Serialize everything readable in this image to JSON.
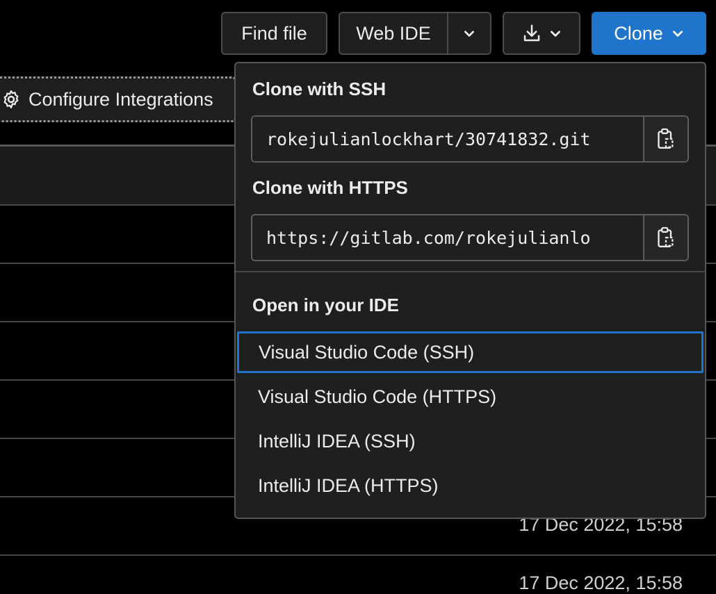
{
  "toolbar": {
    "find_file": "Find file",
    "web_ide": "Web IDE",
    "clone": "Clone",
    "icons": {
      "web_ide_caret": "chevron-down-icon",
      "download": "download-icon",
      "download_caret": "chevron-down-icon",
      "clone_caret": "chevron-down-icon"
    }
  },
  "configure": {
    "label": "Configure Integrations",
    "icon": "gear-icon"
  },
  "rows": [
    {
      "date": "17 Dec 2022, 15:58"
    },
    {
      "date": "17 Dec 2022, 15:58"
    }
  ],
  "clone_dropdown": {
    "ssh_title": "Clone with SSH",
    "ssh_value": "rokejulianlockhart/30741832.git",
    "https_title": "Clone with HTTPS",
    "https_value": "https://gitlab.com/rokejulianlo",
    "ide_title": "Open in your IDE",
    "ide_items": [
      {
        "label": "Visual Studio Code (SSH)"
      },
      {
        "label": "Visual Studio Code (HTTPS)"
      },
      {
        "label": "IntelliJ IDEA (SSH)"
      },
      {
        "label": "IntelliJ IDEA (HTTPS)"
      }
    ],
    "copy_icon": "copy-to-clipboard-icon"
  },
  "colors": {
    "accent": "#1f75cb",
    "background": "#000000",
    "surface": "#1f1f1f",
    "border": "#55555a"
  }
}
